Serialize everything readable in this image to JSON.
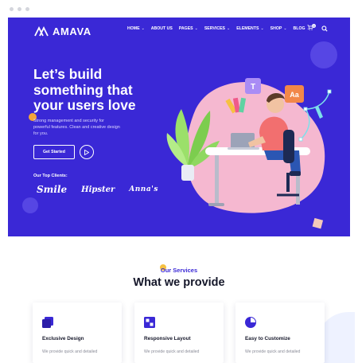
{
  "header": {
    "brand": "AMAVA",
    "nav": [
      {
        "label": "HOME",
        "dropdown": true
      },
      {
        "label": "ABOUT US",
        "dropdown": false
      },
      {
        "label": "PAGES",
        "dropdown": true
      },
      {
        "label": "SERVICES",
        "dropdown": true
      },
      {
        "label": "ELEMENTS",
        "dropdown": true
      },
      {
        "label": "SHOP",
        "dropdown": true
      },
      {
        "label": "BLOG",
        "dropdown": true
      }
    ],
    "cart_count": "0",
    "chevron": "⌄"
  },
  "hero": {
    "headline_line1": "Let’s build",
    "headline_line2": "something that",
    "headline_line3": "your users love",
    "subtext": "Strong management and security for powerful features. Clean and creative design for you.",
    "cta_label": "Get Started",
    "clients_label": "Our Top Clients:",
    "clients": [
      "Smile",
      "Hipster",
      "Anna's"
    ],
    "illustration_badges": [
      "T",
      "Aa"
    ]
  },
  "services": {
    "label": "Our Services",
    "title": "What we provide",
    "cards": [
      {
        "title": "Exclusive Design",
        "desc": "We provide quick and detailed",
        "icon": "layers-icon"
      },
      {
        "title": "Responsive Layout",
        "desc": "We provide quick and detailed",
        "icon": "grid-icon"
      },
      {
        "title": "Easy to Customize",
        "desc": "We provide quick and detailed",
        "icon": "pie-chart-icon"
      }
    ]
  },
  "colors": {
    "hero_bg": "#3a28d6",
    "accent": "#3a28d6",
    "dot": "#f6c142",
    "pink_blob": "#f5b8d0"
  }
}
